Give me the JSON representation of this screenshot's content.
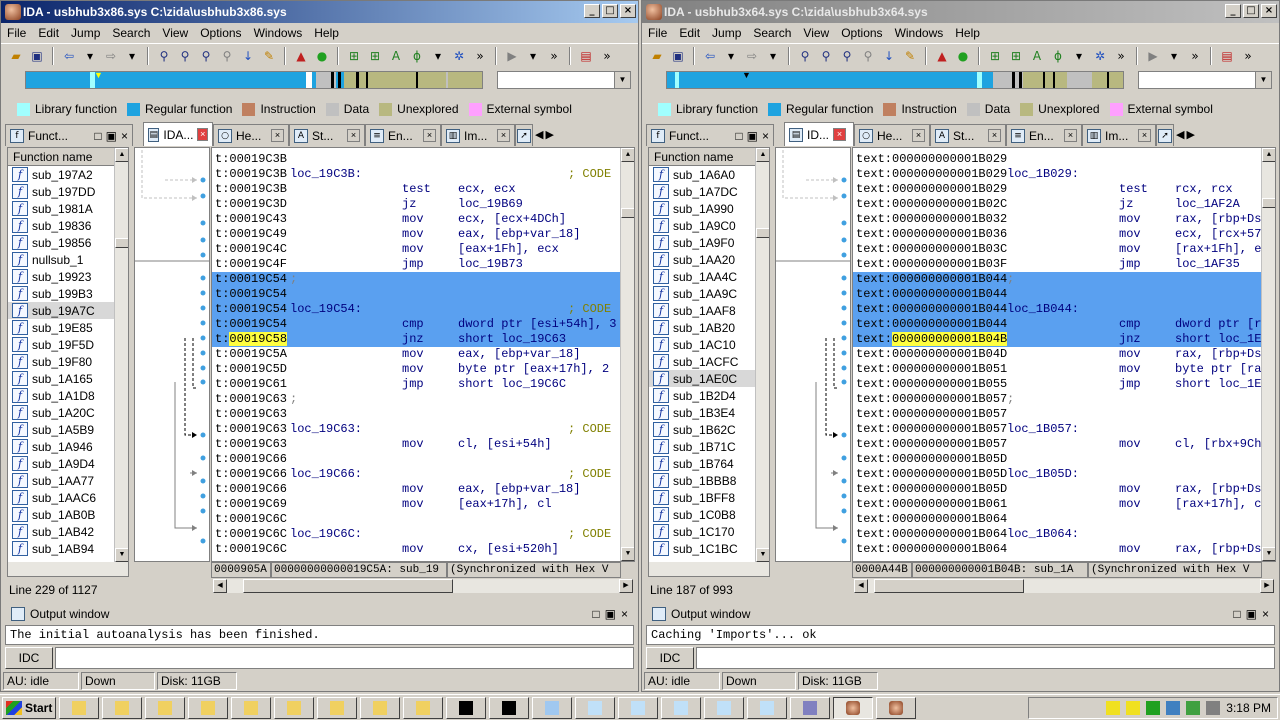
{
  "menu": [
    "File",
    "Edit",
    "Jump",
    "Search",
    "View",
    "Options",
    "Windows",
    "Help"
  ],
  "legend": [
    {
      "label": "Library function",
      "color": "#a0ffff"
    },
    {
      "label": "Regular function",
      "color": "#1ea3e0"
    },
    {
      "label": "Instruction",
      "color": "#c08060"
    },
    {
      "label": "Data",
      "color": "#c0c0c0"
    },
    {
      "label": "Unexplored",
      "color": "#b8b880"
    },
    {
      "label": "External symbol",
      "color": "#ffa0ff"
    }
  ],
  "left": {
    "title": "IDA - usbhub3x86.sys C:\\zida\\usbhub3x86.sys",
    "fn_panel_title": "Funct...",
    "tabs": [
      "IDA...",
      "He...",
      "St...",
      "En...",
      "Im..."
    ],
    "fn_header": "Function name",
    "functions": [
      "sub_197A2",
      "sub_197DD",
      "sub_1981A",
      "sub_19836",
      "sub_19856",
      "nullsub_1",
      "sub_19923",
      "sub_199B3",
      "sub_19A7C",
      "sub_19E85",
      "sub_19F5D",
      "sub_19F80",
      "sub_1A165",
      "sub_1A1D8",
      "sub_1A20C",
      "sub_1A5B9",
      "sub_1A946",
      "sub_1A9D4",
      "sub_1AA77",
      "sub_1AAC6",
      "sub_1AB0B",
      "sub_1AB42",
      "sub_1AB94"
    ],
    "selected_fn": 8,
    "line_count": "Line 229 of 1127",
    "code": [
      {
        "a": "t:00019C3B",
        "l": "",
        "m": "",
        "o": "",
        "c": "",
        "hl": false
      },
      {
        "a": "t:00019C3B",
        "l": "loc_19C3B:",
        "m": "",
        "o": "",
        "c": "; CODE",
        "hl": false
      },
      {
        "a": "t:00019C3B",
        "l": "",
        "m": "test",
        "o": "ecx, ecx",
        "c": "",
        "hl": false
      },
      {
        "a": "t:00019C3D",
        "l": "",
        "m": "jz",
        "o": "loc_19B69",
        "c": "",
        "hl": false
      },
      {
        "a": "t:00019C43",
        "l": "",
        "m": "mov",
        "o": "ecx, [ecx+4DCh]",
        "c": "",
        "hl": false
      },
      {
        "a": "t:00019C49",
        "l": "",
        "m": "mov",
        "o": "eax, [ebp+var_18]",
        "c": "",
        "hl": false
      },
      {
        "a": "t:00019C4C",
        "l": "",
        "m": "mov",
        "o": "[eax+1Fh], ecx",
        "c": "",
        "hl": false
      },
      {
        "a": "t:00019C4F",
        "l": "",
        "m": "jmp",
        "o": "loc_19B73",
        "c": "",
        "hl": false
      },
      {
        "a": "t:00019C54",
        "l": ";",
        "m": "",
        "o": "",
        "c": "",
        "hl": true
      },
      {
        "a": "t:00019C54",
        "l": "",
        "m": "",
        "o": "",
        "c": "",
        "hl": true
      },
      {
        "a": "t:00019C54",
        "l": "loc_19C54:",
        "m": "",
        "o": "",
        "c": "; CODE",
        "hl": true
      },
      {
        "a": "t:00019C54",
        "l": "",
        "m": "cmp",
        "o": "dword ptr [esi+54h], 3",
        "c": "",
        "hl": true
      },
      {
        "a": "t:00019C58",
        "l": "",
        "m": "jnz",
        "o": "short loc_19C63",
        "c": "",
        "hl": true,
        "y": true
      },
      {
        "a": "t:00019C5A",
        "l": "",
        "m": "mov",
        "o": "eax, [ebp+var_18]",
        "c": "",
        "hl": false
      },
      {
        "a": "t:00019C5D",
        "l": "",
        "m": "mov",
        "o": "byte ptr [eax+17h], 2",
        "c": "",
        "hl": false
      },
      {
        "a": "t:00019C61",
        "l": "",
        "m": "jmp",
        "o": "short loc_19C6C",
        "c": "",
        "hl": false
      },
      {
        "a": "t:00019C63",
        "l": ";",
        "m": "",
        "o": "",
        "c": "",
        "hl": false
      },
      {
        "a": "t:00019C63",
        "l": "",
        "m": "",
        "o": "",
        "c": "",
        "hl": false
      },
      {
        "a": "t:00019C63",
        "l": "loc_19C63:",
        "m": "",
        "o": "",
        "c": "; CODE",
        "hl": false
      },
      {
        "a": "t:00019C63",
        "l": "",
        "m": "mov",
        "o": "cl, [esi+54h]",
        "c": "",
        "hl": false
      },
      {
        "a": "t:00019C66",
        "l": "",
        "m": "",
        "o": "",
        "c": "",
        "hl": false
      },
      {
        "a": "t:00019C66",
        "l": "loc_19C66:",
        "m": "",
        "o": "",
        "c": "; CODE",
        "hl": false
      },
      {
        "a": "t:00019C66",
        "l": "",
        "m": "mov",
        "o": "eax, [ebp+var_18]",
        "c": "",
        "hl": false
      },
      {
        "a": "t:00019C69",
        "l": "",
        "m": "mov",
        "o": "[eax+17h], cl",
        "c": "",
        "hl": false
      },
      {
        "a": "t:00019C6C",
        "l": "",
        "m": "",
        "o": "",
        "c": "",
        "hl": false
      },
      {
        "a": "t:00019C6C",
        "l": "loc_19C6C:",
        "m": "",
        "o": "",
        "c": "; CODE",
        "hl": false
      },
      {
        "a": "t:00019C6C",
        "l": "",
        "m": "mov",
        "o": "cx, [esi+520h]",
        "c": "",
        "hl": false
      }
    ],
    "status": [
      "0000905A",
      "00000000000019C5A: sub_19",
      "(Synchronized with Hex V"
    ],
    "output_text": "The initial autoanalysis has been finished."
  },
  "right": {
    "title": "IDA - usbhub3x64.sys C:\\zida\\usbhub3x64.sys",
    "fn_panel_title": "Funct...",
    "tabs": [
      "ID...",
      "He...",
      "St...",
      "En...",
      "Im..."
    ],
    "fn_header": "Function name",
    "functions": [
      "sub_1A6A0",
      "sub_1A7DC",
      "sub_1A990",
      "sub_1A9C0",
      "sub_1A9F0",
      "sub_1AA20",
      "sub_1AA4C",
      "sub_1AA9C",
      "sub_1AAF8",
      "sub_1AB20",
      "sub_1AC10",
      "sub_1ACFC",
      "sub_1AE0C",
      "sub_1B2D4",
      "sub_1B3E4",
      "sub_1B62C",
      "sub_1B71C",
      "sub_1B764",
      "sub_1BBB8",
      "sub_1BFF8",
      "sub_1C0B8",
      "sub_1C170",
      "sub_1C1BC"
    ],
    "selected_fn": 12,
    "line_count": "Line 187 of 993",
    "code": [
      {
        "a": "text:000000000001B029",
        "l": "",
        "m": "",
        "o": "",
        "c": "",
        "hl": false
      },
      {
        "a": "text:000000000001B029",
        "l": "loc_1B029:",
        "m": "",
        "o": "",
        "c": "",
        "hl": false
      },
      {
        "a": "text:000000000001B029",
        "l": "",
        "m": "test",
        "o": "rcx, rcx",
        "c": "",
        "hl": false
      },
      {
        "a": "text:000000000001B02C",
        "l": "",
        "m": "jz",
        "o": "loc_1AF2A",
        "c": "",
        "hl": false
      },
      {
        "a": "text:000000000001B032",
        "l": "",
        "m": "mov",
        "o": "rax, [rbp+Ds",
        "c": "",
        "hl": false
      },
      {
        "a": "text:000000000001B036",
        "l": "",
        "m": "mov",
        "o": "ecx, [rcx+57",
        "c": "",
        "hl": false
      },
      {
        "a": "text:000000000001B03C",
        "l": "",
        "m": "mov",
        "o": "[rax+1Fh], e",
        "c": "",
        "hl": false
      },
      {
        "a": "text:000000000001B03F",
        "l": "",
        "m": "jmp",
        "o": "loc_1AF35",
        "c": "",
        "hl": false
      },
      {
        "a": "text:000000000001B044",
        "l": ";",
        "m": "",
        "o": "",
        "c": "",
        "hl": true
      },
      {
        "a": "text:000000000001B044",
        "l": "",
        "m": "",
        "o": "",
        "c": "",
        "hl": true
      },
      {
        "a": "text:000000000001B044",
        "l": "loc_1B044:",
        "m": "",
        "o": "",
        "c": "",
        "hl": true
      },
      {
        "a": "text:000000000001B044",
        "l": "",
        "m": "cmp",
        "o": "dword ptr [r",
        "c": "",
        "hl": true
      },
      {
        "a": "text:000000000001B04B",
        "l": "",
        "m": "jnz",
        "o": "short loc_1E",
        "c": "",
        "hl": true,
        "y": true
      },
      {
        "a": "text:000000000001B04D",
        "l": "",
        "m": "mov",
        "o": "rax, [rbp+Ds",
        "c": "",
        "hl": false
      },
      {
        "a": "text:000000000001B051",
        "l": "",
        "m": "mov",
        "o": "byte ptr [ra",
        "c": "",
        "hl": false
      },
      {
        "a": "text:000000000001B055",
        "l": "",
        "m": "jmp",
        "o": "short loc_1E",
        "c": "",
        "hl": false
      },
      {
        "a": "text:000000000001B057",
        "l": ";",
        "m": "",
        "o": "",
        "c": "",
        "hl": false
      },
      {
        "a": "text:000000000001B057",
        "l": "",
        "m": "",
        "o": "",
        "c": "",
        "hl": false
      },
      {
        "a": "text:000000000001B057",
        "l": "loc_1B057:",
        "m": "",
        "o": "",
        "c": "",
        "hl": false
      },
      {
        "a": "text:000000000001B057",
        "l": "",
        "m": "mov",
        "o": "cl, [rbx+9Ch",
        "c": "",
        "hl": false
      },
      {
        "a": "text:000000000001B05D",
        "l": "",
        "m": "",
        "o": "",
        "c": "",
        "hl": false
      },
      {
        "a": "text:000000000001B05D",
        "l": "loc_1B05D:",
        "m": "",
        "o": "",
        "c": "",
        "hl": false
      },
      {
        "a": "text:000000000001B05D",
        "l": "",
        "m": "mov",
        "o": "rax, [rbp+Ds",
        "c": "",
        "hl": false
      },
      {
        "a": "text:000000000001B061",
        "l": "",
        "m": "mov",
        "o": "[rax+17h], c",
        "c": "",
        "hl": false
      },
      {
        "a": "text:000000000001B064",
        "l": "",
        "m": "",
        "o": "",
        "c": "",
        "hl": false
      },
      {
        "a": "text:000000000001B064",
        "l": "loc_1B064:",
        "m": "",
        "o": "",
        "c": "",
        "hl": false
      },
      {
        "a": "text:000000000001B064",
        "l": "",
        "m": "mov",
        "o": "rax, [rbp+Ds",
        "c": "",
        "hl": false
      }
    ],
    "status": [
      "0000A44B",
      "000000000001B04B: sub_1A",
      "(Synchronized with Hex V"
    ],
    "output_text": "Caching 'Imports'... ok"
  },
  "common": {
    "output_title": "Output window",
    "idc_label": "IDC",
    "status_au": "AU:  idle",
    "status_dir": "Down",
    "status_disk": "Disk: 11GB"
  },
  "taskbar": {
    "start_label": "Start",
    "clock": "3:18 PM"
  }
}
